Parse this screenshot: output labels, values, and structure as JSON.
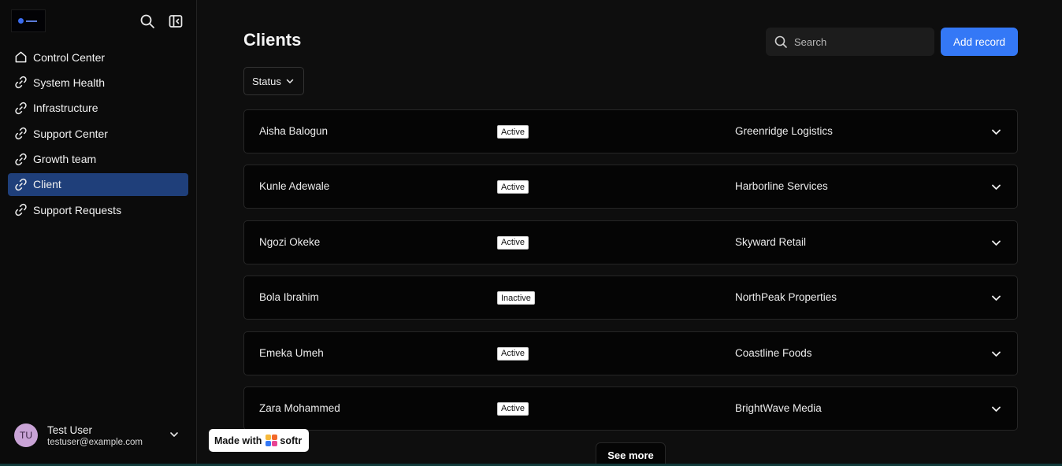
{
  "sidebar": {
    "items": [
      {
        "label": "Control Center",
        "icon": "home-icon",
        "active": false
      },
      {
        "label": "System Health",
        "icon": "link-icon",
        "active": false
      },
      {
        "label": "Infrastructure",
        "icon": "link-icon",
        "active": false
      },
      {
        "label": "Support Center",
        "icon": "link-icon",
        "active": false
      },
      {
        "label": "Growth team",
        "icon": "link-icon",
        "active": false
      },
      {
        "label": "Client",
        "icon": "link-icon",
        "active": true
      },
      {
        "label": "Support Requests",
        "icon": "link-icon",
        "active": false
      }
    ],
    "user": {
      "initials": "TU",
      "name": "Test User",
      "email": "testuser@example.com"
    }
  },
  "main": {
    "title": "Clients",
    "search_placeholder": "Search",
    "add_label": "Add record",
    "filter_label": "Status",
    "see_more_label": "See more",
    "rows": [
      {
        "name": "Aisha Balogun",
        "status": "Active",
        "company": "Greenridge Logistics"
      },
      {
        "name": "Kunle Adewale",
        "status": "Active",
        "company": "Harborline Services"
      },
      {
        "name": "Ngozi Okeke",
        "status": "Active",
        "company": "Skyward Retail"
      },
      {
        "name": "Bola Ibrahim",
        "status": "Inactive",
        "company": "NorthPeak Properties"
      },
      {
        "name": "Emeka Umeh",
        "status": "Active",
        "company": "Coastline Foods"
      },
      {
        "name": "Zara Mohammed",
        "status": "Active",
        "company": "BrightWave Media"
      }
    ]
  },
  "badge": {
    "prefix": "Made with",
    "brand": "softr"
  },
  "colors": {
    "accent": "#3478f6",
    "active_nav": "#1f3f7a",
    "background": "#0e0e0e"
  }
}
